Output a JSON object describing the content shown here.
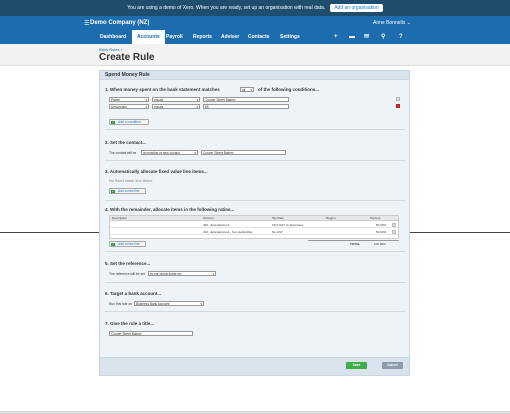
{
  "topbar": {
    "message": "You are using a demo of Xero. When you are ready, set up an organisation with real data.",
    "cta": "Add an organisation"
  },
  "org": {
    "name": "Demo Company (NZ)",
    "user": "Anne Bonnells"
  },
  "nav": {
    "items": [
      "Dashboard",
      "Accounts",
      "Payroll",
      "Reports",
      "Adviser",
      "Contacts",
      "Settings"
    ],
    "active": "Accounts"
  },
  "page": {
    "breadcrumb": "Bank Rules ›",
    "title": "Create Rule"
  },
  "card": {
    "title": "Spend Money Rule"
  },
  "s1": {
    "title_a": "1. When money spent on the bank statement matches",
    "match": "all",
    "title_b": "of the following conditions...",
    "rows": [
      {
        "field": "Payee",
        "op": "equals",
        "value": "Cooper Street Bakery"
      },
      {
        "field": "Description",
        "op": "equals",
        "value": "$5"
      }
    ],
    "add": "Add a condition"
  },
  "s2": {
    "title": "2. Set the contact...",
    "label": "The contact will be",
    "mode": "an existing or new contact",
    "value": "Cooper Street Bakery"
  },
  "s3": {
    "title": "3. Automatically allocate fixed value line items...",
    "empty": "No fixed value line items",
    "add": "Add a new line"
  },
  "s4": {
    "title": "4. With the remainder, allocate items in the following ratios...",
    "headers": [
      "Description",
      "Account",
      "Tax Rate",
      "Region",
      "Percent"
    ],
    "rows": [
      {
        "account": "420 - Entertainment",
        "tax": "15% GST on Expenses",
        "percent": "50.00%"
      },
      {
        "account": "424 - Entertainment - Non deductible",
        "tax": "No GST",
        "percent": "50.00%"
      }
    ],
    "add": "Add a new line",
    "total_label": "TOTAL",
    "total": "100.00%"
  },
  "s5": {
    "title": "5. Set the reference...",
    "label": "The reference will be set",
    "value": "by me during bank rec"
  },
  "s6": {
    "title": "6. Target a bank account...",
    "label": "Run this rule on",
    "value": "Business Bank Account"
  },
  "s7": {
    "title": "7. Give the rule a title...",
    "value": "Cooper Street Bakery"
  },
  "actions": {
    "save": "Save",
    "cancel": "Cancel"
  },
  "colors": {
    "brand": "#1d6cad",
    "save": "#3dae49",
    "cancel": "#8c9bab"
  }
}
